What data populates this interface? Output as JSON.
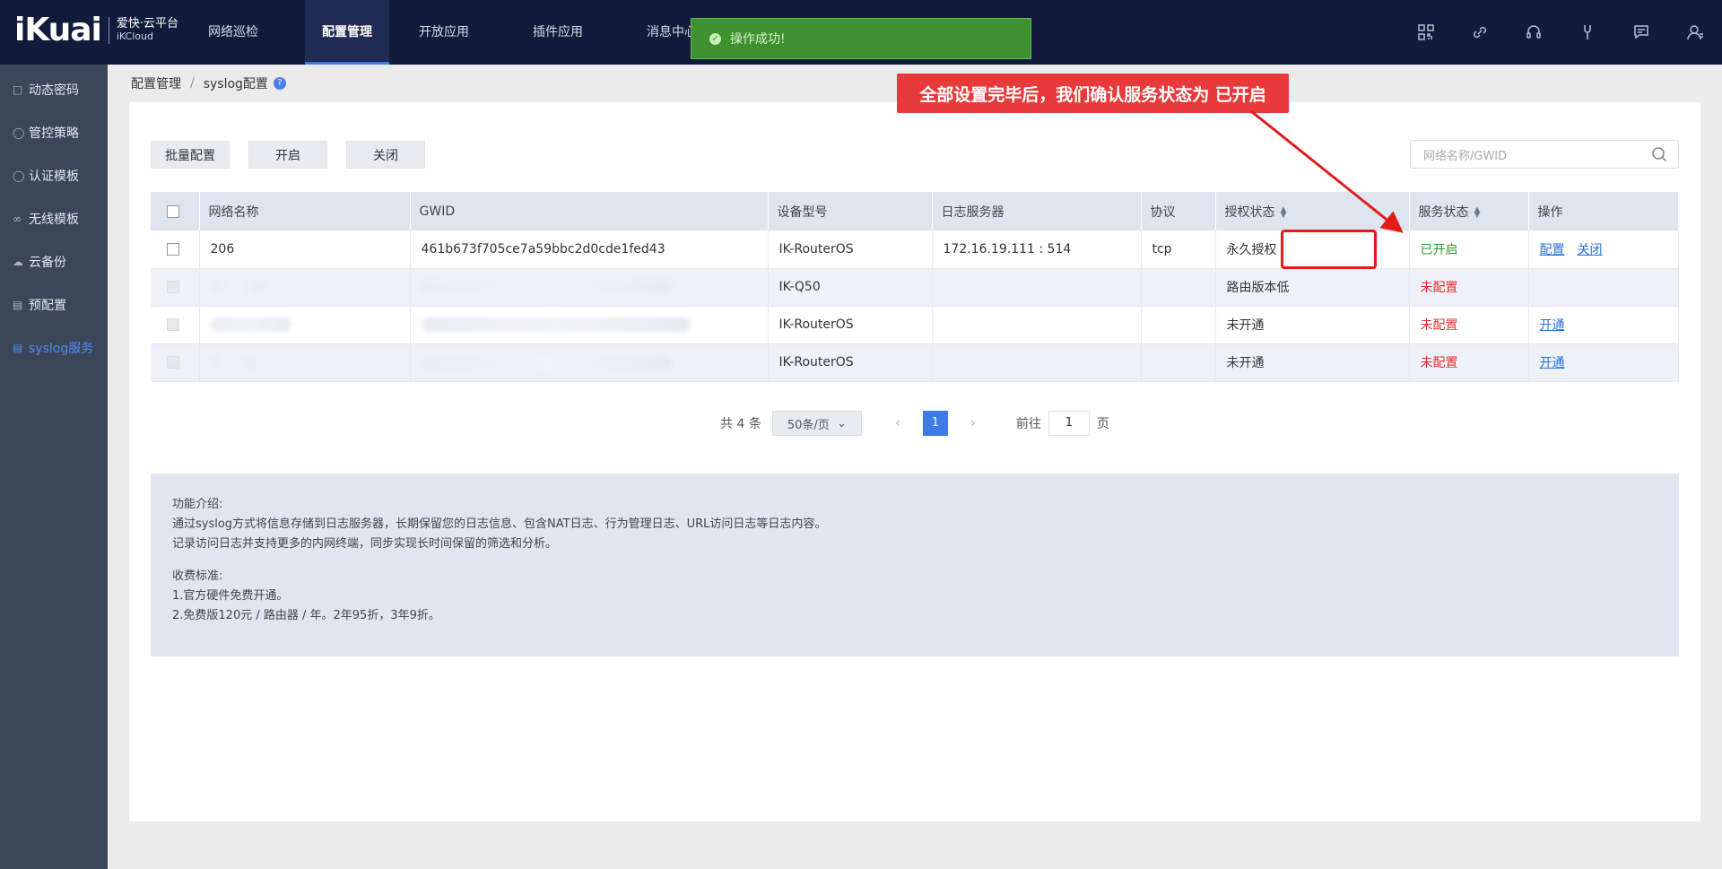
{
  "brand": {
    "logo": "iKuai",
    "name_cn": "爱快·云平台",
    "name_en": "iKCloud"
  },
  "nav": {
    "items": [
      "网络巡检",
      "配置管理",
      "开放应用",
      "插件应用",
      "消息中心"
    ],
    "active": "配置管理"
  },
  "toast": {
    "text": "操作成功!"
  },
  "top_icons": [
    "grid-icon",
    "link-icon",
    "headset-icon",
    "wrench-icon",
    "message-icon",
    "user-icon"
  ],
  "sidebar": {
    "items": [
      {
        "label": "动态密码",
        "icon": "lock-icon"
      },
      {
        "label": "管控策略",
        "icon": "policy-icon"
      },
      {
        "label": "认证模板",
        "icon": "shield-icon"
      },
      {
        "label": "无线模板",
        "icon": "wifi-icon"
      },
      {
        "label": "云备份",
        "icon": "cloud-icon"
      },
      {
        "label": "预配置",
        "icon": "list-icon"
      },
      {
        "label": "syslog服务",
        "icon": "syslog-icon"
      }
    ],
    "active": "syslog服务"
  },
  "breadcrumb": {
    "parent": "配置管理",
    "sep": "/",
    "current": "syslog配置"
  },
  "toolbar": {
    "batch": "批量配置",
    "enable": "开启",
    "disable": "关闭"
  },
  "search": {
    "placeholder": "网络名称/GWID"
  },
  "table": {
    "headers": [
      "网络名称",
      "GWID",
      "设备型号",
      "日志服务器",
      "协议",
      "授权状态",
      "服务状态",
      "操作"
    ],
    "rows": [
      {
        "name": "206",
        "gwid": "461b673f705ce7a59bbc2d0cde1fed43",
        "model": "IK-RouterOS",
        "server": "172.16.19.111 : 514",
        "protocol": "tcp",
        "auth": "永久授权",
        "status": "已开启",
        "actions": [
          "配置",
          "关闭"
        ]
      },
      {
        "name": "",
        "gwid": "",
        "model": "IK-Q50",
        "server": "",
        "protocol": "",
        "auth": "路由版本低",
        "status": "未配置",
        "actions": []
      },
      {
        "name": "",
        "gwid": "",
        "model": "IK-RouterOS",
        "server": "",
        "protocol": "",
        "auth": "未开通",
        "status": "未配置",
        "actions": [
          "开通"
        ]
      },
      {
        "name": "",
        "gwid": "",
        "model": "IK-RouterOS",
        "server": "",
        "protocol": "",
        "auth": "未开通",
        "status": "未配置",
        "actions": [
          "开通"
        ]
      }
    ]
  },
  "pagination": {
    "total": "共 4 条",
    "page_size": "50条/页",
    "current_page": "1",
    "goto_label": "前往",
    "goto_value": "1",
    "page_unit": "页"
  },
  "intro": {
    "title": "功能介绍:",
    "line1": "通过syslog方式将信息存储到日志服务器，长期保留您的日志信息、包含NAT日志、行为管理日志、URL访问日志等日志内容。",
    "line2": "记录访问日志并支持更多的内网终端，同步实现长时间保留的筛选和分析。",
    "fee_title": "收费标准:",
    "fee1": "1.官方硬件免费开通。",
    "fee2": "2.免费版120元 / 路由器 / 年。2年95折，3年9折。"
  },
  "annotation": {
    "text": "全部设置完毕后，我们确认服务状态为 已开启",
    "color": "#e83a3a"
  }
}
